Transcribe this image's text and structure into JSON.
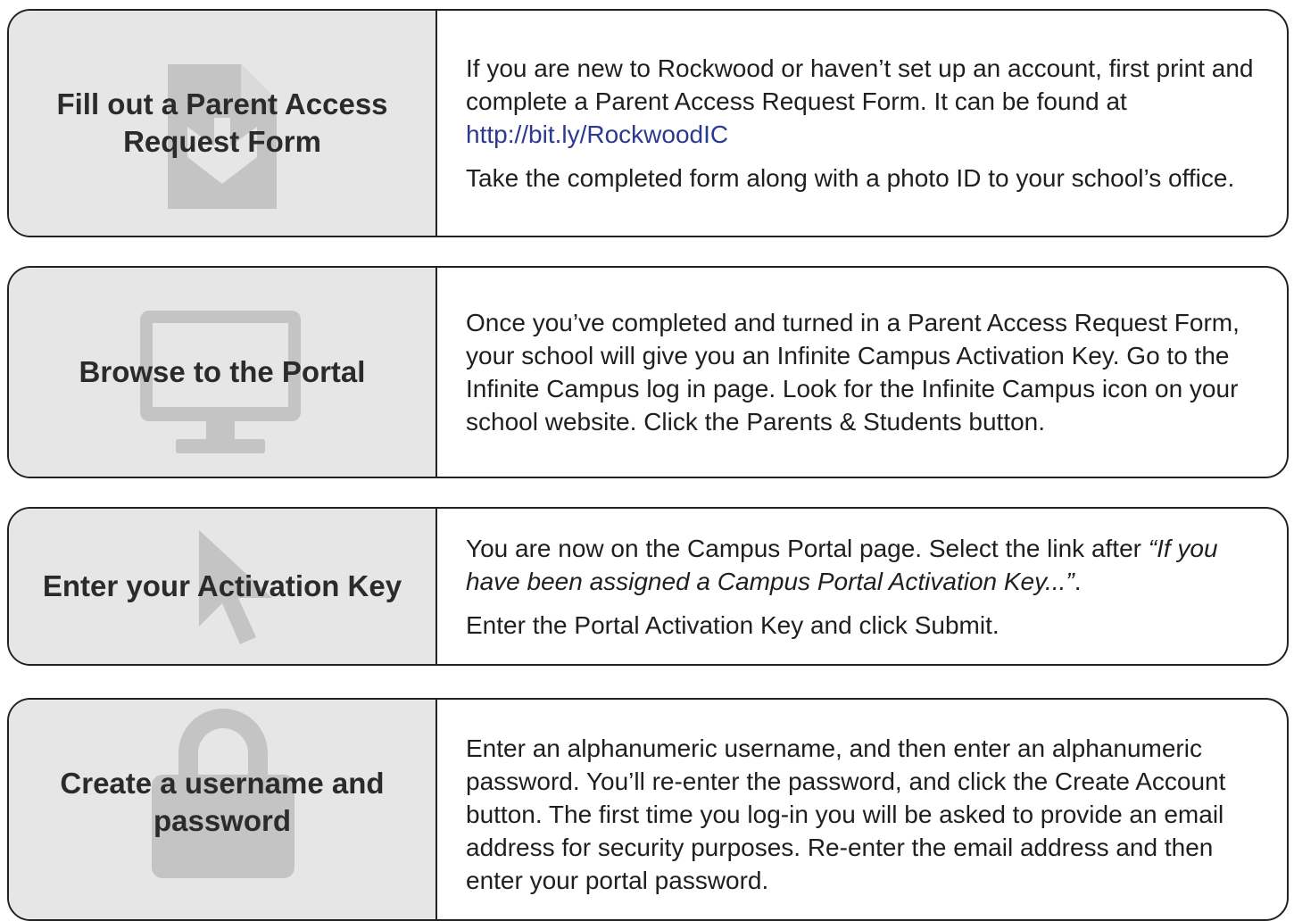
{
  "colors": {
    "border": "#222222",
    "left_panel_bg": "#e6e6e6",
    "icon_fill": "#c4c4c4",
    "link": "#2b3a8f",
    "text": "#1f1f1f"
  },
  "steps": [
    {
      "title": "Fill out a Parent Access Request Form",
      "icon": "document-download-icon",
      "paragraphs": [
        {
          "text": "If you are new to Rockwood or haven’t set up an account, first print and complete a Parent Access Request Form. It can be found at",
          "link": "http://bit.ly/RockwoodIC"
        },
        {
          "text": "Take the completed form along with a photo ID to your school’s office."
        }
      ]
    },
    {
      "title": "Browse to the Portal",
      "icon": "monitor-icon",
      "paragraphs": [
        {
          "text": "Once you’ve completed and turned in a Parent Access Request Form, your school will give you an Infinite Campus Activation Key. Go to the Infinite Campus log in page. Look for the Infinite Campus icon on your school website. Click the Parents & Students button."
        }
      ]
    },
    {
      "title": "Enter your Activation Key",
      "icon": "cursor-arrow-icon",
      "paragraphs": [
        {
          "text_before": "You are now on the Campus Portal page. Select the link after ",
          "italic": "“If you have been assigned a Campus Portal Activation Key...”",
          "text_after": "."
        },
        {
          "text": "Enter the Portal Activation Key and click Submit."
        }
      ]
    },
    {
      "title": "Create a username and password",
      "icon": "padlock-icon",
      "paragraphs": [
        {
          "text": "Enter an alphanumeric username, and then enter an alphanumeric password. You’ll re-enter the password, and click the Create Account button. The first time you log-in you will be asked to provide an email address for security purposes. Re-enter the email address and then enter your portal password."
        }
      ]
    }
  ]
}
